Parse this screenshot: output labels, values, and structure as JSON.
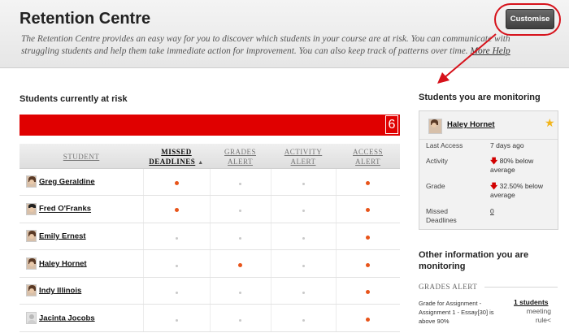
{
  "header": {
    "title": "Retention Centre",
    "intro": "The Retention Centre provides an easy way for you to discover which students in your course are at risk. You can communicate with struggling students and help them take immediate action for improvement. You can also keep track of patterns over time.",
    "more_help": "More Help",
    "customise_label": "Customise"
  },
  "annotation": {
    "color": "#d6121b"
  },
  "risk": {
    "section_title": "Students currently at risk",
    "count": "6",
    "bar_color": "#e00000",
    "columns": [
      {
        "line1": "STUDENT",
        "line2": ""
      },
      {
        "line1": "MISSED",
        "line2": "DEADLINES"
      },
      {
        "line1": "GRADES",
        "line2": "ALERT"
      },
      {
        "line1": "ACTIVITY",
        "line2": "ALERT"
      },
      {
        "line1": "ACCESS",
        "line2": "ALERT"
      }
    ],
    "rows": [
      {
        "name": "Greg Geraldine",
        "avatar": "person-photo",
        "alerts": [
          true,
          false,
          false,
          true
        ]
      },
      {
        "name": "Fred O'Franks",
        "avatar": "person-photo-male",
        "alerts": [
          true,
          false,
          false,
          true
        ]
      },
      {
        "name": "Emily Ernest",
        "avatar": "person-photo",
        "alerts": [
          false,
          false,
          false,
          true
        ]
      },
      {
        "name": "Haley Hornet",
        "avatar": "person-photo",
        "alerts": [
          false,
          true,
          false,
          true
        ]
      },
      {
        "name": "Indy Illinois",
        "avatar": "person-photo",
        "alerts": [
          false,
          false,
          false,
          true
        ]
      },
      {
        "name": "Jacinta Jocobs",
        "avatar": "default-avatar",
        "alerts": [
          false,
          false,
          false,
          true
        ]
      }
    ]
  },
  "monitoring": {
    "section_title": "Students you are monitoring",
    "student_name": "Haley Hornet",
    "star_icon": "star-icon",
    "last_access_label": "Last Access",
    "last_access_value": "7 days ago",
    "activity_label": "Activity",
    "activity_value": "80% below average",
    "grade_label": "Grade",
    "grade_value": "32.50% below average",
    "missed_label": "Missed Deadlines",
    "missed_value": "0"
  },
  "other": {
    "section_title": "Other information you are monitoring",
    "grades_alert_label": "GRADES ALERT",
    "alert_desc": "Grade for Assignment - Assignment 1 - Essay[30] is above 90%",
    "alert_link": "1 students",
    "alert_sub": "meeting rule<"
  }
}
